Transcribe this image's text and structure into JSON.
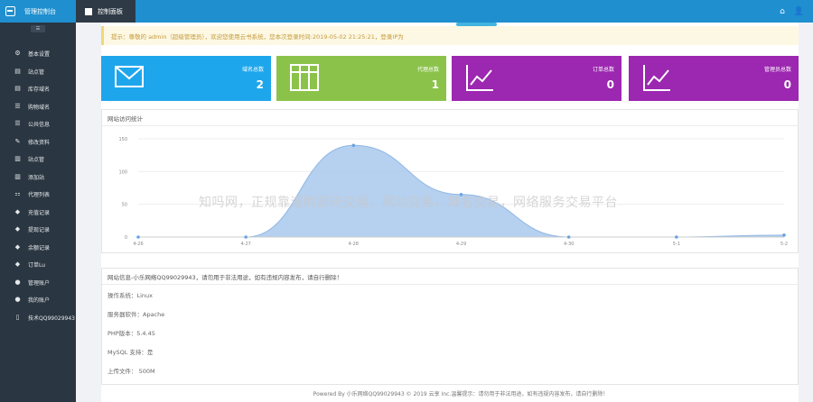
{
  "topbar": {
    "brand": "管理控制台",
    "tab": "控制面板",
    "home_icon": "home-icon",
    "user_icon": "user-icon"
  },
  "sidebar": {
    "collapse": "☰",
    "items": [
      {
        "label": "基本设置",
        "icon": "gears-icon"
      },
      {
        "label": "站点管",
        "icon": "copy-icon"
      },
      {
        "label": "库存域名",
        "icon": "copy-icon"
      },
      {
        "label": "购物域名",
        "icon": "list-icon"
      },
      {
        "label": "公共信息",
        "icon": "list-icon"
      },
      {
        "label": "修改资料",
        "icon": "edit-icon"
      },
      {
        "label": "站点管",
        "icon": "map-icon"
      },
      {
        "label": "添加站",
        "icon": "map-icon"
      },
      {
        "label": "代理列表",
        "icon": "sitemap-icon"
      },
      {
        "label": "充值记录",
        "icon": "tag-icon"
      },
      {
        "label": "提现记录",
        "icon": "tag-icon"
      },
      {
        "label": "余额记录",
        "icon": "tag-icon"
      },
      {
        "label": "订单Lu",
        "icon": "tag-icon"
      },
      {
        "label": "管理账户",
        "icon": "user-icon"
      },
      {
        "label": "我的账户",
        "icon": "user-icon"
      },
      {
        "label": "技术QQ99029943",
        "icon": "mobile-icon"
      }
    ]
  },
  "notice": "提示：尊敬的 admin（超级管理员），欢迎您使用云书系统，您本次登录时间:2019-05-02 21:25:21，登录IP为",
  "cards": [
    {
      "title": "域名总数",
      "value": "2",
      "color": "#1ea6ec",
      "icon": "envelope-icon"
    },
    {
      "title": "代理总数",
      "value": "1",
      "color": "#8bc34a",
      "icon": "table-icon"
    },
    {
      "title": "订单总数",
      "value": "0",
      "color": "#9c27b0",
      "icon": "line-chart-icon"
    },
    {
      "title": "管理员总数",
      "value": "0",
      "color": "#9c27b0",
      "icon": "line-chart-icon"
    }
  ],
  "chart_panel": {
    "title": "网站访问统计"
  },
  "chart_data": {
    "type": "area",
    "categories": [
      "4-26",
      "4-27",
      "4-28",
      "4-29",
      "4-30",
      "5-1",
      "5-2"
    ],
    "values": [
      0,
      0,
      140,
      65,
      0,
      0,
      3
    ],
    "yticks": [
      0,
      50,
      100,
      150
    ],
    "ylim": [
      0,
      150
    ],
    "xlabel": "",
    "ylabel": "",
    "color": "#a9c8ec"
  },
  "info_panel": {
    "title": "网站信息-小乐网络QQ99029943，请勿用于非法用途，如有违规内容发布，请自行删除！",
    "lines": [
      "操作系统：Linux",
      "服务器软件：Apache",
      "PHP版本：5.4.45",
      "MySQL 支持：是",
      "上传文件：  500M"
    ]
  },
  "watermark": "知吗网，正规靠谱的源码交易、网站交易，域名交易，网络服务交易平台",
  "footer": "Powered By 小乐网络QQ99029943 © 2019 云享 Inc.温馨提示：请勿用于非法用途，如有违规内容发布，请自行删除！"
}
